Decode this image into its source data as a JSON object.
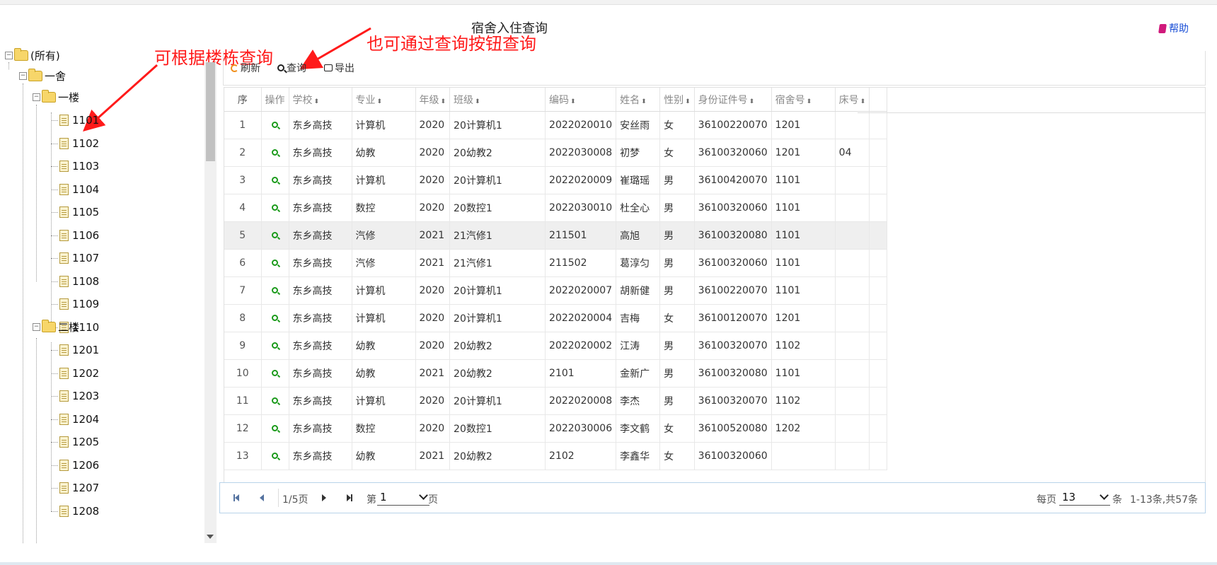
{
  "page_title": "宿舍入住查询",
  "help_label": "帮助",
  "annotations": {
    "tree_hint": "可根据楼栋查询",
    "button_hint": "也可通过查询按钮查询"
  },
  "tree": {
    "root": "(所有)",
    "building": "一舍",
    "floor1": {
      "label": "一楼",
      "rooms": [
        "1101",
        "1102",
        "1103",
        "1104",
        "1105",
        "1106",
        "1107",
        "1108",
        "1109",
        "1110"
      ]
    },
    "floor2": {
      "label": "二楼",
      "rooms": [
        "1201",
        "1202",
        "1203",
        "1204",
        "1205",
        "1206",
        "1207",
        "1208"
      ]
    }
  },
  "toolbar": {
    "refresh": "刷新",
    "query": "查询",
    "export": "导出"
  },
  "table": {
    "headers": [
      "序",
      "操作",
      "学校",
      "专业",
      "年级",
      "班级",
      "编码",
      "姓名",
      "性别",
      "身份证件号",
      "宿舍号",
      "床号"
    ],
    "rows": [
      [
        "1",
        "东乡高技",
        "计算机",
        "2020",
        "20计算机1",
        "2022020010",
        "安丝雨",
        "女",
        "36100220070",
        "1201",
        ""
      ],
      [
        "2",
        "东乡高技",
        "幼教",
        "2020",
        "20幼教2",
        "2022030008",
        "初梦",
        "女",
        "36100320060",
        "1201",
        "04"
      ],
      [
        "3",
        "东乡高技",
        "计算机",
        "2020",
        "20计算机1",
        "2022020009",
        "崔璐瑶",
        "男",
        "36100420070",
        "1101",
        ""
      ],
      [
        "4",
        "东乡高技",
        "数控",
        "2020",
        "20数控1",
        "2022030010",
        "杜全心",
        "男",
        "36100320060",
        "1101",
        ""
      ],
      [
        "5",
        "东乡高技",
        "汽修",
        "2021",
        "21汽修1",
        "211501",
        "高旭",
        "男",
        "36100320080",
        "1101",
        ""
      ],
      [
        "6",
        "东乡高技",
        "汽修",
        "2021",
        "21汽修1",
        "211502",
        "葛淳匀",
        "男",
        "36100320060",
        "1101",
        ""
      ],
      [
        "7",
        "东乡高技",
        "计算机",
        "2020",
        "20计算机1",
        "2022020007",
        "胡新健",
        "男",
        "36100220070",
        "1101",
        ""
      ],
      [
        "8",
        "东乡高技",
        "计算机",
        "2020",
        "20计算机1",
        "2022020004",
        "吉梅",
        "女",
        "36100120070",
        "1201",
        ""
      ],
      [
        "9",
        "东乡高技",
        "幼教",
        "2020",
        "20幼教2",
        "2022020002",
        "江涛",
        "男",
        "36100320070",
        "1102",
        ""
      ],
      [
        "10",
        "东乡高技",
        "幼教",
        "2021",
        "20幼教2",
        "2101",
        "金新广",
        "男",
        "36100320080",
        "1101",
        ""
      ],
      [
        "11",
        "东乡高技",
        "计算机",
        "2020",
        "20计算机1",
        "2022020008",
        "李杰",
        "男",
        "36100320070",
        "1102",
        ""
      ],
      [
        "12",
        "东乡高技",
        "数控",
        "2020",
        "20数控1",
        "2022030006",
        "李文鹤",
        "女",
        "36100520080",
        "1202",
        ""
      ],
      [
        "13",
        "东乡高技",
        "幼教",
        "2021",
        "20幼教2",
        "2102",
        "李鑫华",
        "女",
        "36100320060",
        "",
        ""
      ]
    ],
    "highlighted_row": 5
  },
  "pager": {
    "page_info": "1/5页",
    "goto_prefix": "第",
    "goto_value": "1",
    "goto_suffix": "页",
    "per_page_prefix": "每页",
    "per_page_value": "13",
    "per_page_suffix": "条",
    "summary": "1-13条,共57条"
  }
}
